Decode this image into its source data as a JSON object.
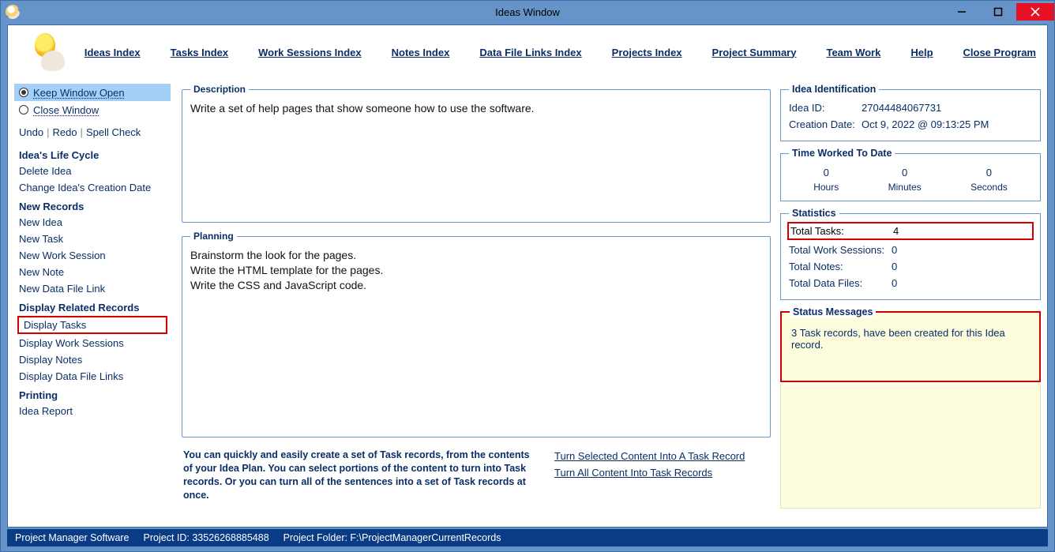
{
  "window": {
    "title": "Ideas Window"
  },
  "menu": {
    "ideas_index": "Ideas Index",
    "tasks_index": "Tasks Index",
    "work_sessions_index": "Work Sessions Index",
    "notes_index": "Notes Index",
    "data_file_links_index": "Data File Links Index",
    "projects_index": "Projects Index",
    "project_summary": "Project Summary",
    "team_work": "Team Work",
    "help": "Help",
    "close_program": "Close Program"
  },
  "sidebar": {
    "keep_open": "Keep Window Open",
    "close_window": "Close Window",
    "undo": "Undo",
    "redo": "Redo",
    "spell_check": "Spell Check",
    "life_cycle_heading": "Idea's Life Cycle",
    "delete_idea": "Delete Idea",
    "change_creation_date": "Change Idea's Creation Date",
    "new_records_heading": "New Records",
    "new_idea": "New Idea",
    "new_task": "New Task",
    "new_work_session": "New Work Session",
    "new_note": "New Note",
    "new_data_file_link": "New Data File Link",
    "display_related_heading": "Display Related Records",
    "display_tasks": "Display Tasks",
    "display_work_sessions": "Display Work Sessions",
    "display_notes": "Display Notes",
    "display_data_file_links": "Display Data File Links",
    "printing_heading": "Printing",
    "idea_report": "Idea Report"
  },
  "center": {
    "description_legend": "Description",
    "description_text": "Write a set of help pages that show someone how to use the software.",
    "planning_legend": "Planning",
    "planning_text": "Brainstorm the look for the pages.\nWrite the HTML template for the pages.\nWrite the CSS and JavaScript code.",
    "helper_text": "You can quickly and easily create a set of Task records, from the contents of your Idea Plan. You can select portions of the content to turn into Task records. Or you can turn all of the sentences into a set of Task records at once.",
    "turn_selected": "Turn Selected Content Into A Task Record",
    "turn_all": "Turn All Content Into Task Records"
  },
  "right": {
    "identification_legend": "Idea Identification",
    "idea_id_label": "Idea ID:",
    "idea_id_value": "27044484067731",
    "creation_date_label": "Creation Date:",
    "creation_date_value": "Oct  9, 2022 @ 09:13:25 PM",
    "time_legend": "Time Worked To Date",
    "hours_value": "0",
    "hours_label": "Hours",
    "minutes_value": "0",
    "minutes_label": "Minutes",
    "seconds_value": "0",
    "seconds_label": "Seconds",
    "stats_legend": "Statistics",
    "total_tasks_label": "Total Tasks:",
    "total_tasks_value": "4",
    "total_ws_label": "Total Work Sessions:",
    "total_ws_value": "0",
    "total_notes_label": "Total Notes:",
    "total_notes_value": "0",
    "total_df_label": "Total Data Files:",
    "total_df_value": "0",
    "status_legend": "Status Messages",
    "status_text": "3 Task records, have been created for this Idea record."
  },
  "statusbar": {
    "app": "Project Manager Software",
    "project_id": "Project ID:  33526268885488",
    "project_folder": "Project Folder: F:\\ProjectManagerCurrentRecords"
  }
}
